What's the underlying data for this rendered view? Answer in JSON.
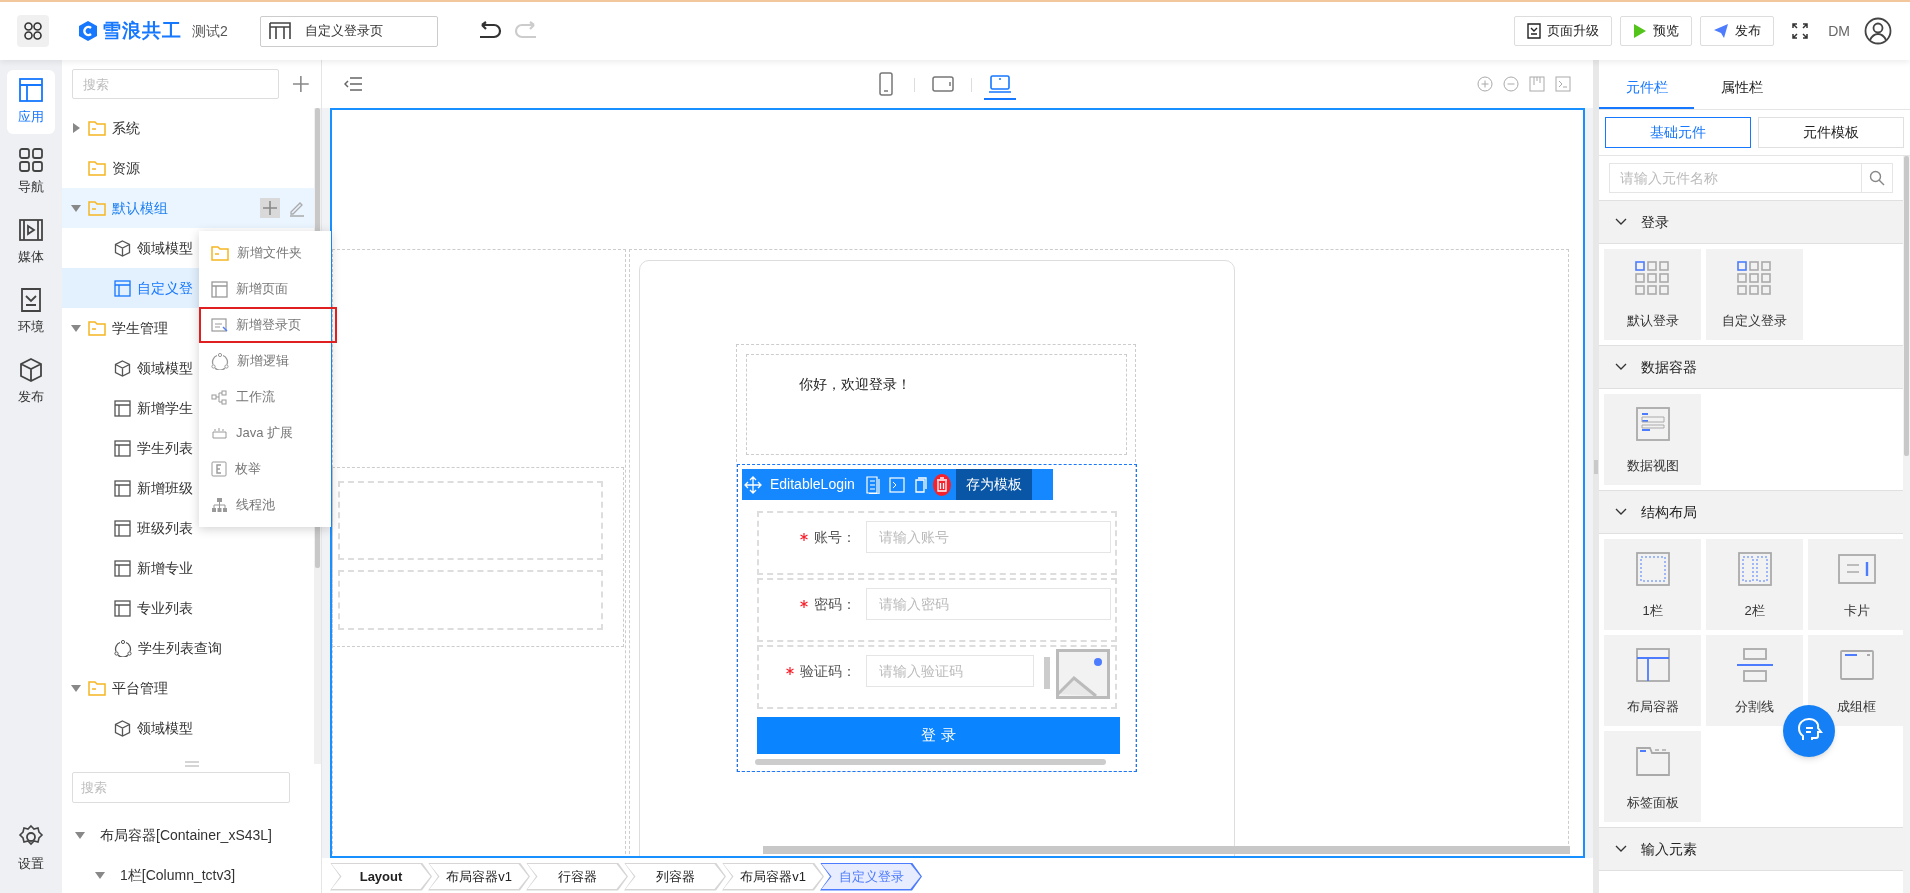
{
  "topbar": {
    "app_name": "雪浪共工",
    "project": "测试2",
    "page_selector": "自定义登录页",
    "undo_enabled": true,
    "redo_enabled": false,
    "buttons": [
      {
        "label": "页面升级",
        "kind": "upgrade"
      },
      {
        "label": "预览",
        "kind": "preview"
      },
      {
        "label": "发布",
        "kind": "publish"
      }
    ],
    "user": "DM"
  },
  "rail": [
    {
      "label": "应用",
      "kind": "app",
      "selected": true
    },
    {
      "label": "导航",
      "kind": "nav",
      "selected": false
    },
    {
      "label": "媒体",
      "kind": "media",
      "selected": false
    },
    {
      "label": "环境",
      "kind": "env",
      "selected": false
    },
    {
      "label": "发布",
      "kind": "publish",
      "selected": false
    },
    {
      "label": "设置",
      "kind": "settings",
      "selected": false
    }
  ],
  "tree": {
    "search_placeholder": "搜索",
    "items": [
      {
        "label": "系统",
        "kind": "folder",
        "expanded": false,
        "selected": false,
        "hovered": false
      },
      {
        "label": "资源",
        "kind": "folder",
        "selected": false,
        "hovered": false
      },
      {
        "label": "默认模组",
        "kind": "folder",
        "expanded": true,
        "selected": false,
        "hovered": true,
        "children": [
          {
            "label": "领域模型",
            "kind": "model",
            "selected": false,
            "hovered": false
          },
          {
            "label": "自定义登",
            "kind": "page",
            "selected": true,
            "hovered": false
          }
        ]
      },
      {
        "label": "学生管理",
        "kind": "folder",
        "expanded": true,
        "selected": false,
        "hovered": false,
        "children": [
          {
            "label": "领域模型",
            "kind": "model",
            "selected": false,
            "hovered": false
          },
          {
            "label": "新增学生",
            "kind": "page",
            "selected": false,
            "hovered": false
          },
          {
            "label": "学生列表",
            "kind": "page",
            "selected": false,
            "hovered": false
          },
          {
            "label": "新增班级",
            "kind": "page",
            "selected": false,
            "hovered": false
          },
          {
            "label": "班级列表",
            "kind": "page",
            "selected": false,
            "hovered": false
          },
          {
            "label": "新增专业",
            "kind": "page",
            "selected": false,
            "hovered": false
          },
          {
            "label": "专业列表",
            "kind": "page",
            "selected": false,
            "hovered": false
          },
          {
            "label": "学生列表查询",
            "kind": "logic",
            "selected": false,
            "hovered": false
          }
        ]
      },
      {
        "label": "平台管理",
        "kind": "folder",
        "expanded": true,
        "selected": false,
        "hovered": false,
        "children": [
          {
            "label": "领域模型",
            "kind": "model",
            "selected": false,
            "hovered": false
          }
        ]
      }
    ]
  },
  "context_menu": [
    {
      "label": "新增文件夹",
      "kind": "folder",
      "highlighted": false
    },
    {
      "label": "新增页面",
      "kind": "page",
      "highlighted": false
    },
    {
      "label": "新增登录页",
      "kind": "login",
      "highlighted": true
    },
    {
      "label": "新增逻辑",
      "kind": "logic",
      "highlighted": false
    },
    {
      "label": "工作流",
      "kind": "workflow",
      "highlighted": false
    },
    {
      "label": "Java 扩展",
      "kind": "java",
      "highlighted": false
    },
    {
      "label": "枚举",
      "kind": "enum",
      "highlighted": false
    },
    {
      "label": "线程池",
      "kind": "pool",
      "highlighted": false
    }
  ],
  "outline": {
    "search_placeholder": "搜索",
    "items": [
      {
        "label": "布局容器[Container_xS43L]",
        "expanded": true,
        "children": [
          {
            "label": "1栏[Column_tctv3]",
            "expanded": true
          }
        ]
      }
    ]
  },
  "canvas": {
    "devices": [
      {
        "kind": "phone",
        "selected": false
      },
      {
        "kind": "tablet",
        "selected": false
      },
      {
        "kind": "laptop",
        "selected": true
      }
    ],
    "greeting": "你好，欢迎登录！",
    "component_name": "EditableLogin",
    "save_template": "存为模板",
    "fields": [
      {
        "kind": "text",
        "label": "账号：",
        "placeholder": "请输入账号",
        "required": true
      },
      {
        "kind": "password",
        "label": "密码：",
        "placeholder": "请输入密码",
        "required": true
      },
      {
        "kind": "captcha",
        "label": "验证码：",
        "placeholder": "请输入验证码",
        "required": true
      }
    ],
    "submit": "登 录"
  },
  "breadcrumb": [
    {
      "label": "Layout",
      "selected": false
    },
    {
      "label": "布局容器v1",
      "selected": false
    },
    {
      "label": "行容器",
      "selected": false
    },
    {
      "label": "列容器",
      "selected": false
    },
    {
      "label": "布局容器v1",
      "selected": false
    },
    {
      "label": "自定义登录",
      "selected": true
    }
  ],
  "right_panel": {
    "tabs": [
      {
        "label": "元件栏",
        "selected": true
      },
      {
        "label": "属性栏",
        "selected": false
      }
    ],
    "subtabs": [
      {
        "label": "基础元件",
        "selected": true
      },
      {
        "label": "元件模板",
        "selected": false
      }
    ],
    "search_placeholder": "请输入元件名称",
    "sections": [
      {
        "title": "登录",
        "expanded": true,
        "items": [
          {
            "label": "默认登录",
            "kind": "grid"
          },
          {
            "label": "自定义登录",
            "kind": "grid"
          }
        ]
      },
      {
        "title": "数据容器",
        "expanded": true,
        "items": [
          {
            "label": "数据视图",
            "kind": "dataview"
          }
        ]
      },
      {
        "title": "结构布局",
        "expanded": true,
        "items": [
          {
            "label": "1栏",
            "kind": "col1"
          },
          {
            "label": "2栏",
            "kind": "col2"
          },
          {
            "label": "卡片",
            "kind": "card"
          },
          {
            "label": "布局容器",
            "kind": "layout"
          },
          {
            "label": "分割线",
            "kind": "divider"
          },
          {
            "label": "成组框",
            "kind": "group"
          },
          {
            "label": "标签面板",
            "kind": "tabs"
          }
        ]
      },
      {
        "title": "输入元素",
        "expanded": true
      }
    ]
  }
}
